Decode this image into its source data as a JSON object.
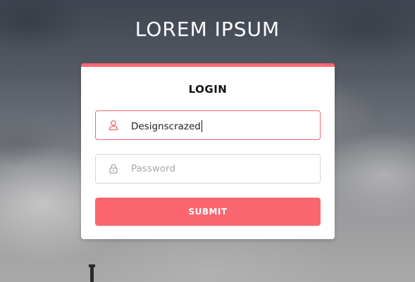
{
  "logo": {
    "text": "LOREM IPSUM"
  },
  "login_card": {
    "title": "LOGIN",
    "username": {
      "value": "Designscrazed",
      "icon": "user-icon"
    },
    "password": {
      "placeholder": "Password",
      "icon": "lock-icon"
    },
    "submit_label": "SUBMIT"
  },
  "colors": {
    "accent": "#fb6671",
    "active_border": "#f06a70"
  }
}
